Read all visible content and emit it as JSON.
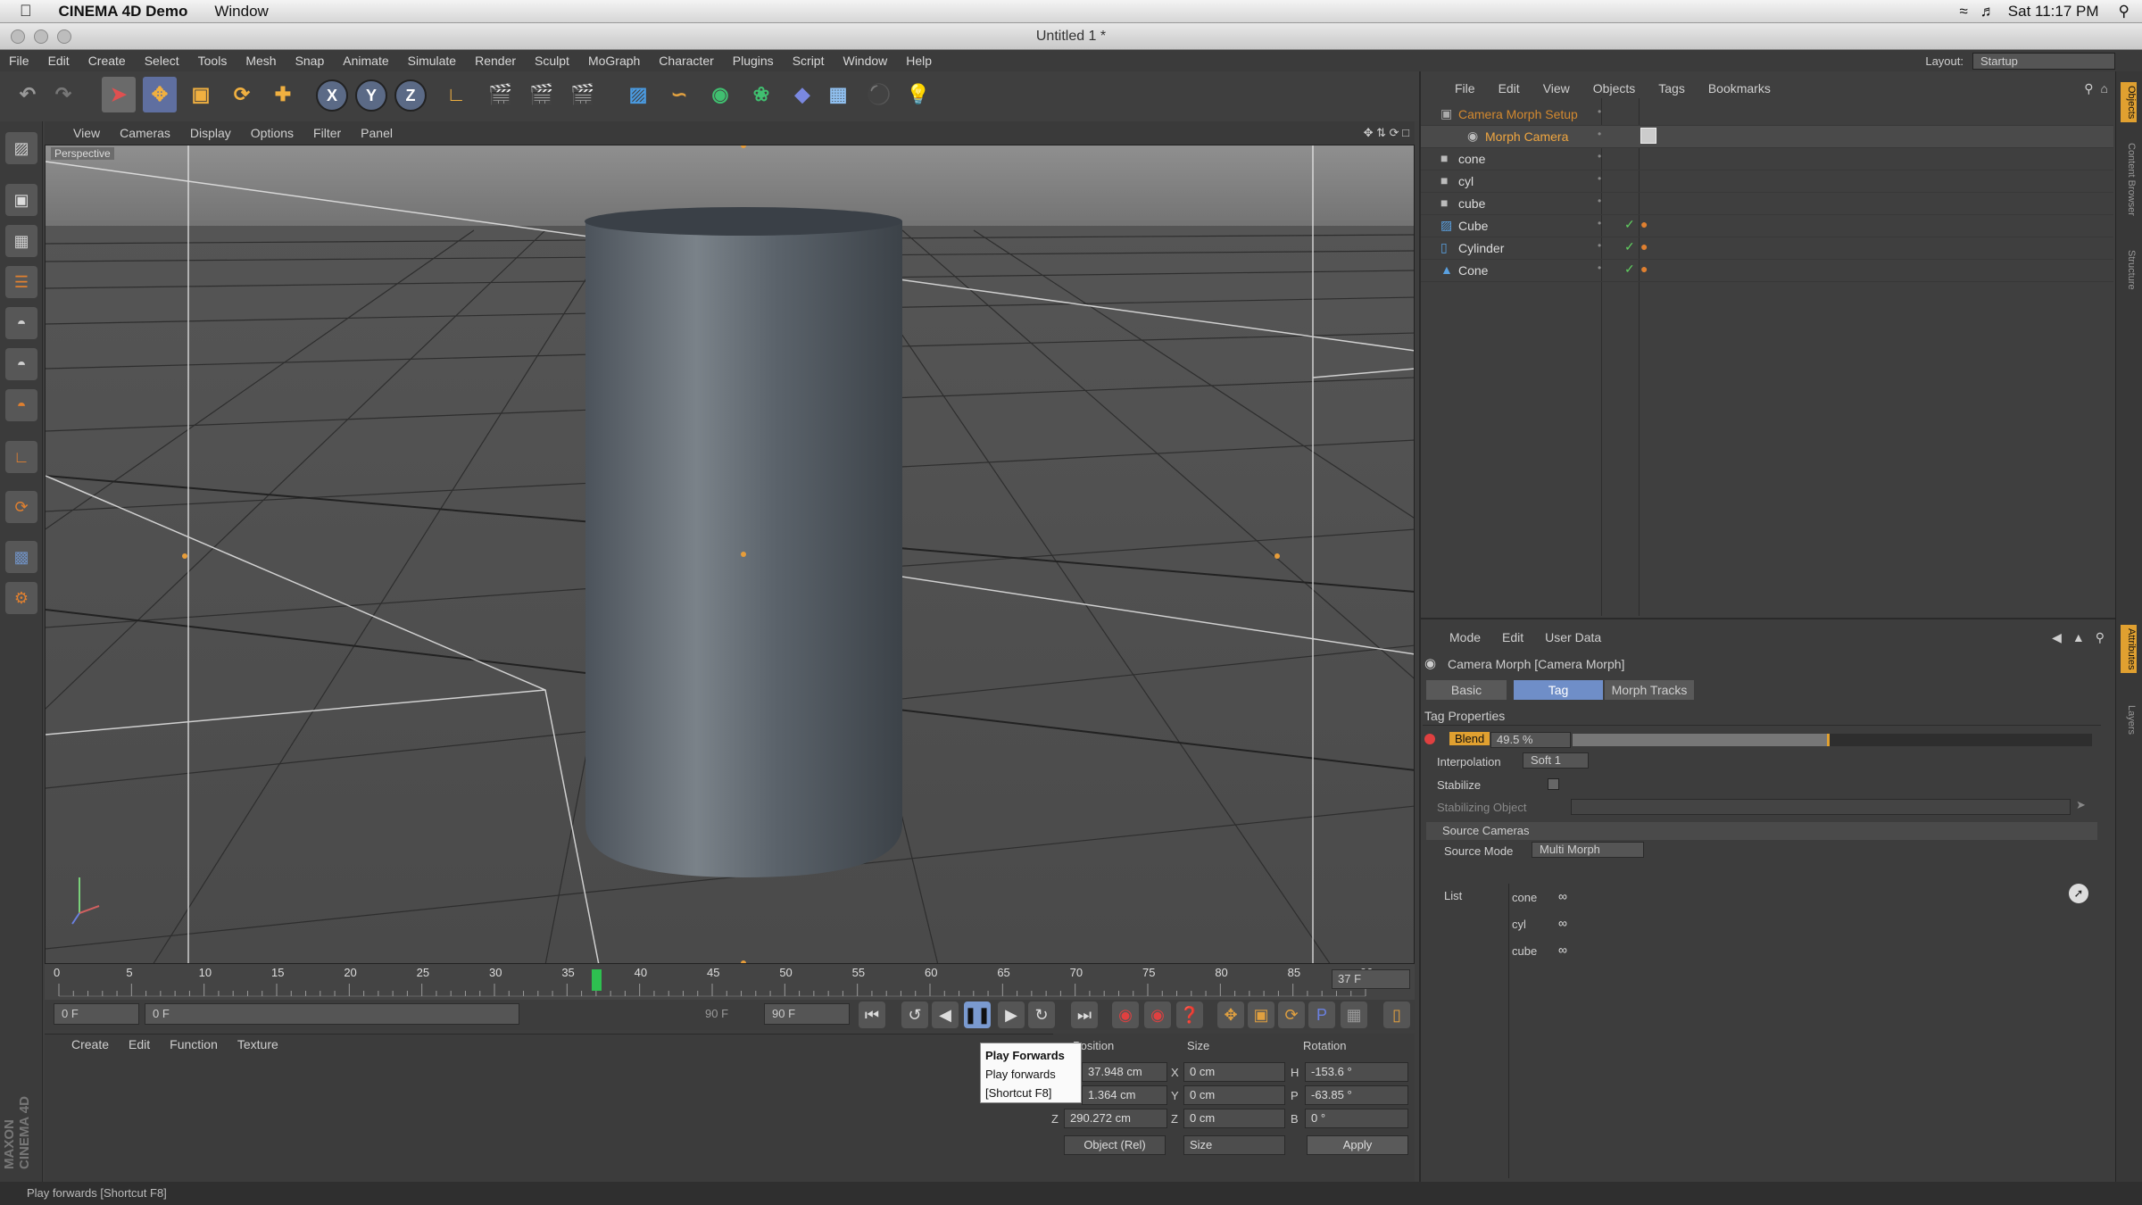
{
  "mac_menubar": {
    "app": "CINEMA 4D Demo",
    "window": "Window",
    "clock": "Sat 11:17 PM"
  },
  "window": {
    "title": "Untitled 1 *"
  },
  "main_menu": [
    "File",
    "Edit",
    "Create",
    "Select",
    "Tools",
    "Mesh",
    "Snap",
    "Animate",
    "Simulate",
    "Render",
    "Sculpt",
    "MoGraph",
    "Character",
    "Plugins",
    "Script",
    "Window",
    "Help"
  ],
  "layout": {
    "label": "Layout:",
    "value": "Startup"
  },
  "toolbar": {
    "axis_x": "X",
    "axis_y": "Y",
    "axis_z": "Z"
  },
  "viewport": {
    "menu": [
      "View",
      "Cameras",
      "Display",
      "Options",
      "Filter",
      "Panel"
    ],
    "label": "Perspective"
  },
  "timeline": {
    "ticks": [
      "0",
      "5",
      "10",
      "15",
      "20",
      "25",
      "30",
      "35",
      "40",
      "45",
      "50",
      "55",
      "60",
      "65",
      "70",
      "75",
      "80",
      "85",
      "90"
    ],
    "current_frame": "37 F",
    "current_frame_value": 37
  },
  "transport": {
    "start": "0 F",
    "range_start": "0 F",
    "range_end": "90 F",
    "end": "90 F"
  },
  "tooltip": {
    "title": "Play Forwards",
    "desc": "Play forwards",
    "shortcut": "[Shortcut F8]"
  },
  "material_menu": [
    "Create",
    "Edit",
    "Function",
    "Texture"
  ],
  "coordinates": {
    "headers": [
      "Position",
      "Size",
      "Rotation"
    ],
    "pos": [
      "37.948 cm",
      "1.364 cm",
      "290.272 cm"
    ],
    "size": [
      "0 cm",
      "0 cm",
      "0 cm"
    ],
    "rot": [
      "-153.6 °",
      "-63.85 °",
      "0 °"
    ],
    "axis_labels": [
      "X",
      "Y",
      "Z"
    ],
    "rot_labels": [
      "H",
      "P",
      "B"
    ],
    "mode": "Object (Rel)",
    "size_mode": "Size",
    "apply": "Apply"
  },
  "object_menu": [
    "File",
    "Edit",
    "View",
    "Objects",
    "Tags",
    "Bookmarks"
  ],
  "objects": [
    {
      "name": "Camera Morph Setup",
      "color": "#d3892f"
    },
    {
      "name": "Morph Camera",
      "color": "#f0a640"
    },
    {
      "name": "cone",
      "color": "#dddddd"
    },
    {
      "name": "cyl",
      "color": "#dddddd"
    },
    {
      "name": "cube",
      "color": "#dddddd"
    },
    {
      "name": "Cube",
      "color": "#dddddd"
    },
    {
      "name": "Cylinder",
      "color": "#dddddd"
    },
    {
      "name": "Cone",
      "color": "#dddddd"
    }
  ],
  "attributes": {
    "menu": [
      "Mode",
      "Edit",
      "User Data"
    ],
    "header": "Camera Morph [Camera Morph]",
    "tabs": [
      "Basic",
      "Tag",
      "Morph Tracks"
    ],
    "section": "Tag Properties",
    "blend_label": "Blend",
    "blend_value": "49.5 %",
    "blend_fraction": 0.495,
    "interp_label": "Interpolation",
    "interp_value": "Soft 1",
    "stabilize_label": "Stabilize",
    "stab_obj_label": "Stabilizing Object",
    "source_cameras": "Source Cameras",
    "source_mode_label": "Source Mode",
    "source_mode_value": "Multi Morph",
    "list_label": "List",
    "list_items": [
      "cone",
      "cyl",
      "cube"
    ]
  },
  "side_tabs": [
    "Objects",
    "Content Browser",
    "Structure",
    "Attributes",
    "Layers"
  ],
  "brand": "MAXON CINEMA 4D",
  "status": "Play forwards [Shortcut F8]"
}
